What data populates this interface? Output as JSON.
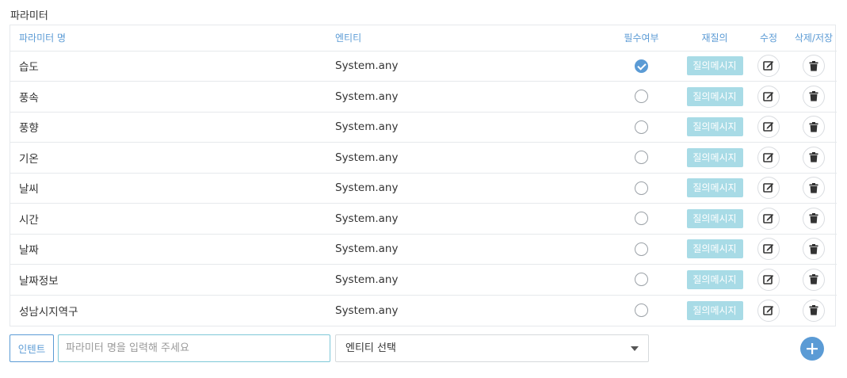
{
  "section_title": "파라미터",
  "headers": {
    "name": "파라미터 명",
    "entity": "엔티티",
    "required": "필수여부",
    "reask": "재질의",
    "edit": "수정",
    "delete": "삭제/저장"
  },
  "rows": [
    {
      "name": "습도",
      "entity": "System.any",
      "required": true,
      "reask_label": "질의메시지"
    },
    {
      "name": "풍속",
      "entity": "System.any",
      "required": false,
      "reask_label": "질의메시지"
    },
    {
      "name": "풍향",
      "entity": "System.any",
      "required": false,
      "reask_label": "질의메시지"
    },
    {
      "name": "기온",
      "entity": "System.any",
      "required": false,
      "reask_label": "질의메시지"
    },
    {
      "name": "날씨",
      "entity": "System.any",
      "required": false,
      "reask_label": "질의메시지"
    },
    {
      "name": "시간",
      "entity": "System.any",
      "required": false,
      "reask_label": "질의메시지"
    },
    {
      "name": "날짜",
      "entity": "System.any",
      "required": false,
      "reask_label": "질의메시지"
    },
    {
      "name": "날짜정보",
      "entity": "System.any",
      "required": false,
      "reask_label": "질의메시지"
    },
    {
      "name": "성남시지역구",
      "entity": "System.any",
      "required": false,
      "reask_label": "질의메시지"
    }
  ],
  "bottom": {
    "intent_label": "인텐트",
    "param_placeholder": "파라미터 명을 입력해 주세요",
    "entity_select_label": "엔티티 선택",
    "add_icon": "plus-icon"
  },
  "colors": {
    "accent": "#5b9bd5",
    "reask_button": "#a8dbe6",
    "input_border": "#7ec8d8"
  }
}
